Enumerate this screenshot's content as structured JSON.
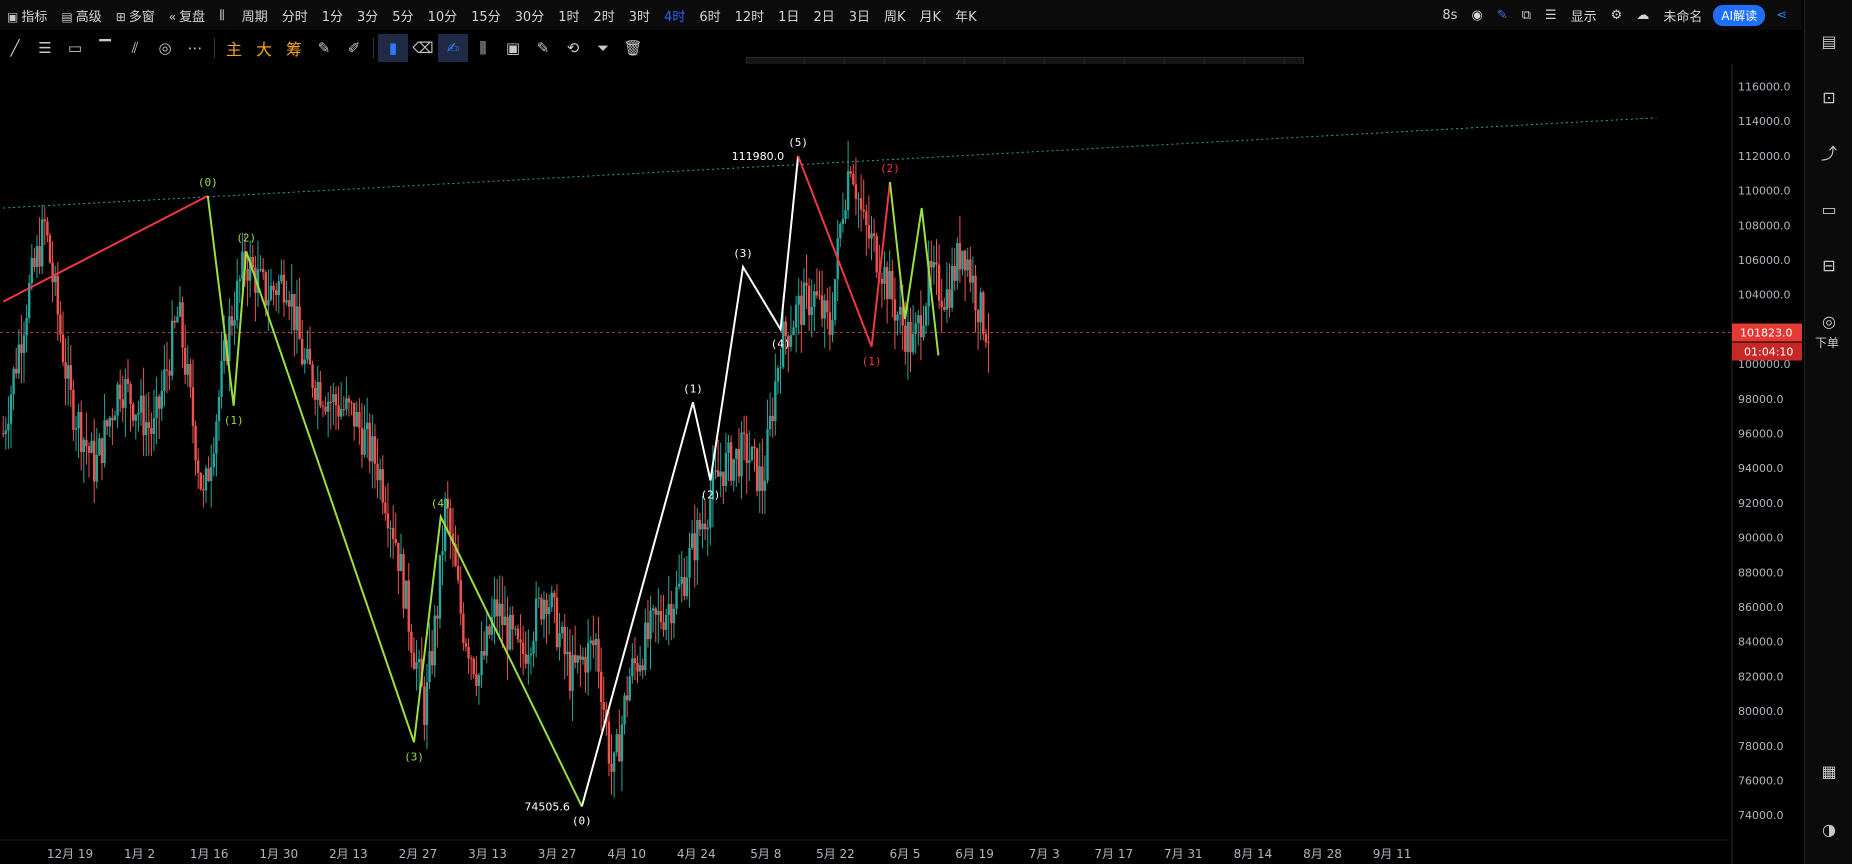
{
  "topbar": {
    "items": [
      {
        "icon": "chart-icon",
        "label": "指标"
      },
      {
        "icon": "calendar-icon",
        "label": "高级"
      },
      {
        "icon": "grid-icon",
        "label": "多窗"
      },
      {
        "icon": "rewind-icon",
        "label": "复盘"
      },
      {
        "icon": "candles-icon",
        "label": ""
      },
      {
        "icon": "",
        "label": "周期"
      },
      {
        "icon": "",
        "label": "分时"
      },
      {
        "icon": "",
        "label": "1分"
      },
      {
        "icon": "",
        "label": "3分"
      },
      {
        "icon": "",
        "label": "5分"
      },
      {
        "icon": "",
        "label": "10分"
      },
      {
        "icon": "",
        "label": "15分"
      },
      {
        "icon": "",
        "label": "30分"
      },
      {
        "icon": "",
        "label": "1时"
      },
      {
        "icon": "",
        "label": "2时"
      },
      {
        "icon": "",
        "label": "3时"
      },
      {
        "icon": "",
        "label": "4时"
      },
      {
        "icon": "",
        "label": "6时"
      },
      {
        "icon": "",
        "label": "12时"
      },
      {
        "icon": "",
        "label": "1日"
      },
      {
        "icon": "",
        "label": "2日"
      },
      {
        "icon": "",
        "label": "3日"
      },
      {
        "icon": "",
        "label": "周K"
      },
      {
        "icon": "",
        "label": "月K"
      },
      {
        "icon": "",
        "label": "年K"
      }
    ],
    "active_index": 16,
    "refresh": "8s",
    "display_label": "显示",
    "layout_name": "未命名",
    "ai_label": "AI解读"
  },
  "toolbar2": {
    "text_tools": [
      "主",
      "大",
      "筹"
    ]
  },
  "rightbar": {
    "order_label": "下单"
  },
  "chart_data": {
    "type": "candlestick",
    "x_ticks": [
      "12月 19",
      "1月 2",
      "1月 16",
      "1月 30",
      "2月 13",
      "2月 27",
      "3月 13",
      "3月 27",
      "4月 10",
      "4月 24",
      "5月 8",
      "5月 22",
      "6月 5",
      "6月 19",
      "7月 3",
      "7月 17",
      "7月 31",
      "8月 14",
      "8月 28",
      "9月 11"
    ],
    "x_tick_fracs": [
      0.0,
      0.0833,
      0.1667,
      0.25,
      0.3333,
      0.4167,
      0.5,
      0.5833,
      0.6667,
      0.75,
      0.8333,
      0.9167,
      1.0,
      1.0833,
      1.1667,
      1.25,
      1.3333,
      1.4167,
      1.5,
      1.5833
    ],
    "y_ticks": [
      74000,
      76000,
      78000,
      80000,
      82000,
      84000,
      86000,
      88000,
      90000,
      92000,
      94000,
      96000,
      98000,
      100000,
      102000,
      104000,
      106000,
      108000,
      110000,
      112000,
      114000,
      116000
    ],
    "ylim": [
      72800,
      117300
    ],
    "last_price": "101823.0",
    "countdown": "01:04:10",
    "price_path": [
      [
        -0.08,
        96000
      ],
      [
        -0.05,
        104000
      ],
      [
        -0.03,
        108000
      ],
      [
        0.0,
        98000
      ],
      [
        0.03,
        94000
      ],
      [
        0.06,
        99000
      ],
      [
        0.1,
        96000
      ],
      [
        0.13,
        103000
      ],
      [
        0.16,
        92000
      ],
      [
        0.19,
        102000
      ],
      [
        0.21,
        106000
      ],
      [
        0.235,
        104000
      ],
      [
        0.26,
        105000
      ],
      [
        0.28,
        100000
      ],
      [
        0.31,
        98000
      ],
      [
        0.34,
        97000
      ],
      [
        0.37,
        94000
      ],
      [
        0.39,
        90000
      ],
      [
        0.41,
        84000
      ],
      [
        0.425,
        80000
      ],
      [
        0.44,
        86000
      ],
      [
        0.45,
        92000
      ],
      [
        0.47,
        85000
      ],
      [
        0.49,
        82000
      ],
      [
        0.51,
        86000
      ],
      [
        0.54,
        83000
      ],
      [
        0.57,
        87000
      ],
      [
        0.6,
        82000
      ],
      [
        0.63,
        84000
      ],
      [
        0.65,
        76000
      ],
      [
        0.67,
        82000
      ],
      [
        0.7,
        85000
      ],
      [
        0.73,
        87000
      ],
      [
        0.75,
        90000
      ],
      [
        0.78,
        94000
      ],
      [
        0.81,
        95000
      ],
      [
        0.83,
        93000
      ],
      [
        0.85,
        101000
      ],
      [
        0.87,
        103000
      ],
      [
        0.89,
        104000
      ],
      [
        0.91,
        102000
      ],
      [
        0.925,
        109000
      ],
      [
        0.935,
        112000
      ],
      [
        0.95,
        108000
      ],
      [
        0.97,
        106000
      ],
      [
        0.99,
        103000
      ],
      [
        1.01,
        101000
      ],
      [
        1.03,
        105000
      ],
      [
        1.05,
        104000
      ],
      [
        1.07,
        107000
      ],
      [
        1.09,
        103000
      ],
      [
        1.1,
        101800
      ]
    ],
    "annotations": {
      "low_label": "74505.6",
      "high_label": "111980.0"
    },
    "waves": [
      {
        "color": "#f23645",
        "points": [
          [
            -0.08,
            103600
          ],
          [
            0.165,
            109700
          ]
        ],
        "labels": []
      },
      {
        "color": "#9be03c",
        "points": [
          [
            0.165,
            109700
          ],
          [
            0.196,
            97600
          ],
          [
            0.211,
            106500
          ],
          [
            0.412,
            78200
          ],
          [
            0.444,
            91200
          ],
          [
            0.613,
            74500
          ]
        ],
        "labels": [
          "(0)",
          "(1)",
          "(2)",
          "(3)",
          "(4)",
          ""
        ]
      },
      {
        "color": "#ffffff",
        "points": [
          [
            0.613,
            74500
          ],
          [
            0.746,
            97800
          ],
          [
            0.767,
            93300
          ],
          [
            0.806,
            105600
          ],
          [
            0.851,
            102000
          ],
          [
            0.872,
            112000
          ]
        ],
        "labels": [
          "(0)",
          "(1)",
          "(2)",
          "(3)",
          "(4)",
          "(5)"
        ]
      },
      {
        "color": "#f23645",
        "points": [
          [
            0.872,
            112000
          ],
          [
            0.96,
            101000
          ],
          [
            0.982,
            110500
          ]
        ],
        "labels": [
          "",
          "(1)",
          "(2)"
        ]
      },
      {
        "color": "#9be03c",
        "points": [
          [
            0.982,
            110500
          ],
          [
            1.0,
            102600
          ],
          [
            1.02,
            109000
          ],
          [
            1.04,
            100500
          ]
        ],
        "labels": []
      }
    ],
    "trendline": {
      "color": "#26a69a",
      "points": [
        [
          -0.08,
          109000
        ],
        [
          1.9,
          114200
        ]
      ]
    },
    "up_color": "#26a69a",
    "down_color": "#ef5350"
  }
}
